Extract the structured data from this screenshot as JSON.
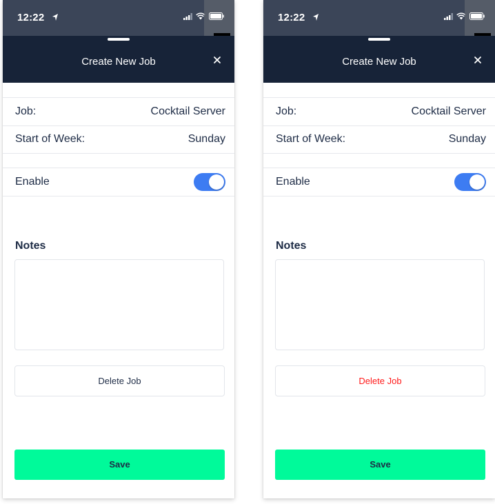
{
  "colors": {
    "header_bg": "#172338",
    "status_bar_bg": "#3b4558",
    "text_primary": "#1d2b45",
    "toggle_on": "#3d7cf2",
    "save_bg": "#00fa9a",
    "delete_default": "#1d2b45",
    "delete_danger": "#ff1a1a"
  },
  "screens": [
    {
      "status_bar": {
        "time": "12:22"
      },
      "header": {
        "title": "Create New Job",
        "close_label": "×"
      },
      "job": {
        "label": "Job:",
        "value": "Cocktail Server"
      },
      "start_of_week": {
        "label": "Start of Week:",
        "value": "Sunday"
      },
      "enable": {
        "label": "Enable",
        "on": true
      },
      "notes": {
        "label": "Notes",
        "value": ""
      },
      "delete_button": {
        "label": "Delete Job",
        "color": "#1d2b45"
      },
      "save_button": {
        "label": "Save"
      }
    },
    {
      "status_bar": {
        "time": "12:22"
      },
      "header": {
        "title": "Create New Job",
        "close_label": "×"
      },
      "job": {
        "label": "Job:",
        "value": "Cocktail Server"
      },
      "start_of_week": {
        "label": "Start of Week:",
        "value": "Sunday"
      },
      "enable": {
        "label": "Enable",
        "on": true
      },
      "notes": {
        "label": "Notes",
        "value": ""
      },
      "delete_button": {
        "label": "Delete Job",
        "color": "#ff1a1a"
      },
      "save_button": {
        "label": "Save"
      }
    }
  ]
}
